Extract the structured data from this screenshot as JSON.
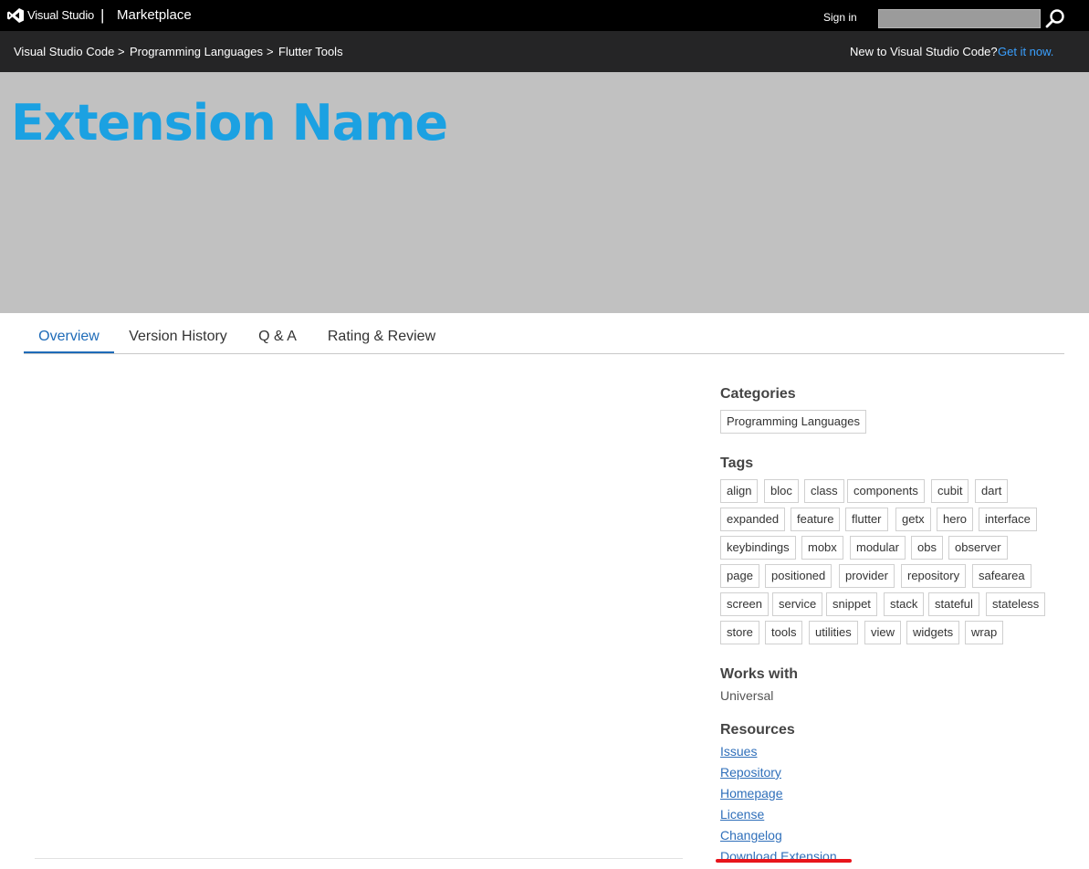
{
  "header": {
    "brand": "Visual Studio",
    "separator": "|",
    "product": "Marketplace",
    "sign_in": "Sign in",
    "search_value": ""
  },
  "breadcrumb": {
    "items": [
      "Visual Studio Code",
      "Programming Languages",
      "Flutter Tools"
    ],
    "separator": ">",
    "new_to_text": "New to Visual Studio Code?",
    "get_it_now": "Get it now."
  },
  "banner": {
    "extension_name": "Extension Name",
    "background": "#c1c1c1",
    "title_color": "#1ba1e2"
  },
  "tabs": [
    "Overview",
    "Version History",
    "Q & A",
    "Rating & Review"
  ],
  "active_tab": "Overview",
  "sidebar": {
    "categories_heading": "Categories",
    "categories": [
      "Programming Languages"
    ],
    "tags_heading": "Tags",
    "tags": [
      [
        "align",
        "bloc",
        "class",
        "components",
        "cubit",
        "dart"
      ],
      [
        "expanded",
        "feature",
        "flutter",
        "getx",
        "hero",
        "interface"
      ],
      [
        "keybindings",
        "mobx",
        "modular",
        "obs",
        "observer"
      ],
      [
        "page",
        "positioned",
        "provider",
        "repository",
        "safearea"
      ],
      [
        "screen",
        "service",
        "snippet",
        "stack",
        "stateful",
        "stateless"
      ],
      [
        "store",
        "tools",
        "utilities",
        "view",
        "widgets",
        "wrap"
      ]
    ],
    "works_with_heading": "Works with",
    "works_with": "Universal",
    "resources_heading": "Resources",
    "resources": [
      "Issues",
      "Repository",
      "Homepage",
      "License",
      "Changelog",
      "Download Extension"
    ]
  },
  "colors": {
    "top_bar": "#000000",
    "breadcrumb_bar": "#252526",
    "link": "#2f6fba",
    "highlight_underline": "#e8141b"
  }
}
